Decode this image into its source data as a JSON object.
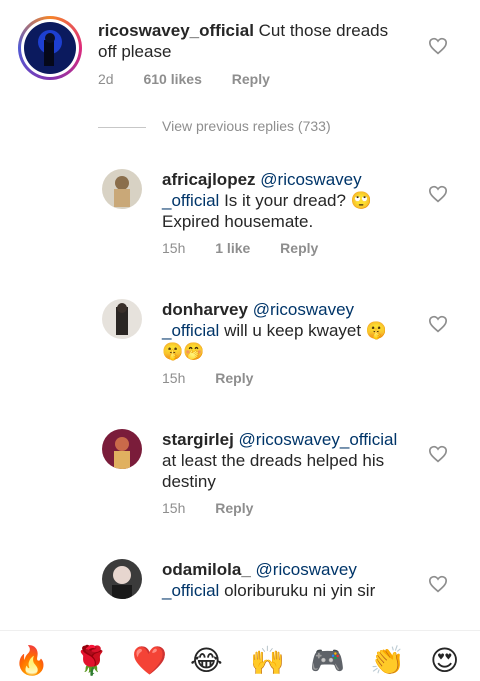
{
  "main_comment": {
    "username": "ricoswavey_official",
    "text": " Cut those dreads off please",
    "time": "2d",
    "likes": "610 likes",
    "reply": "Reply"
  },
  "view_previous": "View previous replies (733)",
  "replies": [
    {
      "username": "africajlopez",
      "mention": "@ricoswavey _official",
      "text": " Is it your dread? 🙄 Expired housemate.",
      "time": "15h",
      "likes": "1 like",
      "reply": "Reply"
    },
    {
      "username": "donharvey",
      "mention": "@ricoswavey _official",
      "text": " will u keep kwayet 🤫 🤫🤭",
      "time": "15h",
      "likes": "",
      "reply": "Reply"
    },
    {
      "username": "stargirlej",
      "mention": "@ricoswavey_official",
      "text": " at least the dreads helped his destiny",
      "time": "15h",
      "likes": "",
      "reply": "Reply"
    },
    {
      "username": "odamilola_",
      "mention": "@ricoswavey _official",
      "text": " oloriburuku ni yin sir",
      "time": "",
      "likes": "",
      "reply": ""
    }
  ],
  "emoji_bar": [
    "🔥",
    "🌹",
    "❤️",
    "😂",
    "🙌",
    "🎮",
    "👏",
    "😍"
  ],
  "colors": {
    "text": "#262626",
    "meta": "#8e8e8e",
    "mention": "#003569",
    "heart_stroke": "#8e8e8e"
  }
}
